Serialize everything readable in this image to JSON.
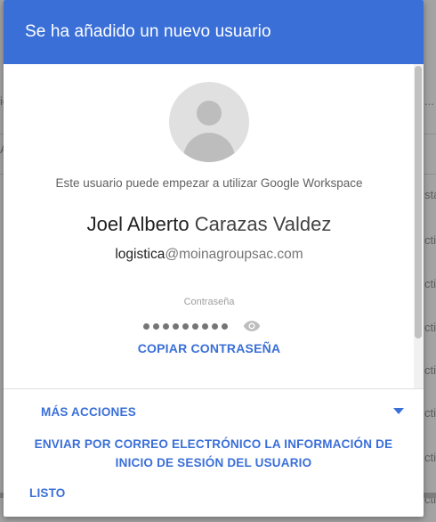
{
  "background": {
    "edge_fragments_left": [
      "ic",
      "A"
    ],
    "edge_fragments_right": [
      "...",
      "sta",
      "ctiv",
      "ctiv",
      "ctiv",
      "ctiv",
      "ctiv",
      "ctiv",
      "ctiv"
    ]
  },
  "dialog": {
    "title": "Se ha añadido un nuevo usuario",
    "info_text": "Este usuario puede empezar a utilizar Google Workspace",
    "user": {
      "first_name": "Joel Alberto",
      "last_name": "Carazas Valdez",
      "email_local": "logistica",
      "email_domain": "@moinagroupsac.com"
    },
    "password": {
      "label": "Contraseña",
      "masked_length": 9,
      "copy_label": "COPIAR CONTRASEÑA"
    },
    "footer": {
      "more_actions_label": "MÁS ACCIONES",
      "email_info_label": "ENVIAR POR CORREO ELECTRÓNICO LA INFORMACIÓN DE INICIO DE SESIÓN DEL USUARIO",
      "done_label": "LISTO"
    }
  },
  "colors": {
    "header": "#3a6fd8",
    "accent": "#3a6fd8",
    "overlay": "#a3a3a3"
  },
  "icons": [
    "avatar-placeholder-icon",
    "eye-icon",
    "chevron-down-icon"
  ]
}
